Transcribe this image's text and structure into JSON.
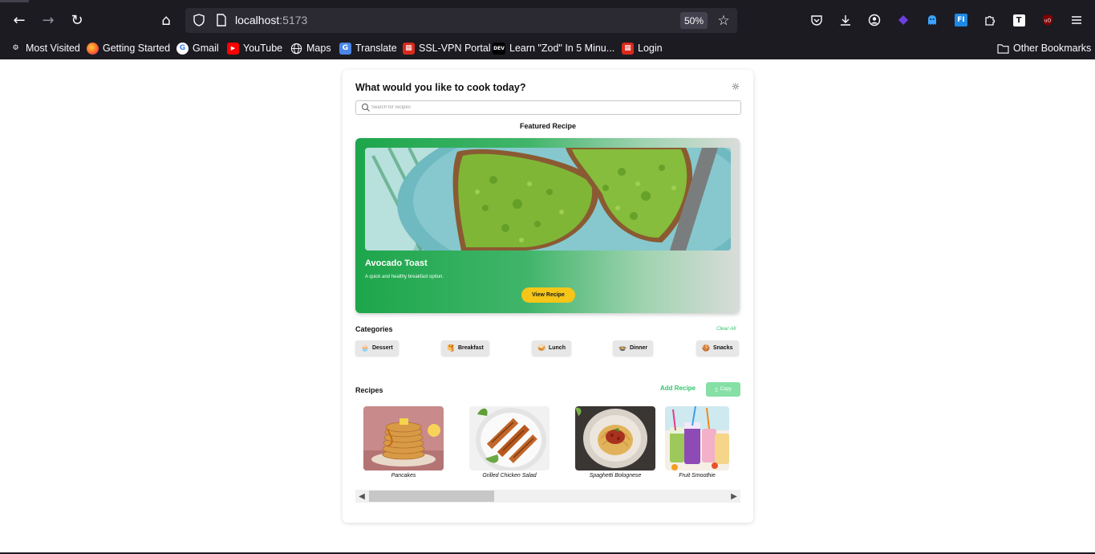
{
  "browser": {
    "url_host": "localhost",
    "url_port": ":5173",
    "zoom": "50%",
    "bookmarks": [
      {
        "label": "Most Visited",
        "icon": "gear-icon"
      },
      {
        "label": "Getting Started",
        "icon": "firefox-icon"
      },
      {
        "label": "Gmail",
        "icon": "google-icon"
      },
      {
        "label": "YouTube",
        "icon": "youtube-icon"
      },
      {
        "label": "Maps",
        "icon": "globe-icon"
      },
      {
        "label": "Translate",
        "icon": "translate-icon"
      },
      {
        "label": "SSL-VPN Portal",
        "icon": "vpn-icon"
      },
      {
        "label": "Learn \"Zod\" In 5 Minu...",
        "icon": "dev-icon"
      },
      {
        "label": "Login",
        "icon": "login-icon"
      }
    ],
    "other_bookmarks": "Other Bookmarks"
  },
  "app": {
    "title": "What would you like to cook today?",
    "search_placeholder": "Search for recipes",
    "featured_heading": "Featured Recipe",
    "featured": {
      "title": "Avocado Toast",
      "description": "A quick and healthy breakfast option.",
      "button": "View Recipe"
    },
    "categories_heading": "Categories",
    "clear_all": "Clear All",
    "categories": [
      "Dessert",
      "Breakfast",
      "Lunch",
      "Dinner",
      "Snacks"
    ],
    "recipes_heading": "Recipes",
    "add_recipe": "Add Recipe",
    "copy": "Copy",
    "recipes": [
      "Pancakes",
      "Grilled Chicken Salad",
      "Spaghetti Bolognese",
      "Fruit Smoothie"
    ]
  },
  "colors": {
    "accent_green": "#33c56a",
    "featured_gradient_start": "#1da64b",
    "view_button_yellow": "#f5c518",
    "chrome_bg": "#1c1b22"
  }
}
